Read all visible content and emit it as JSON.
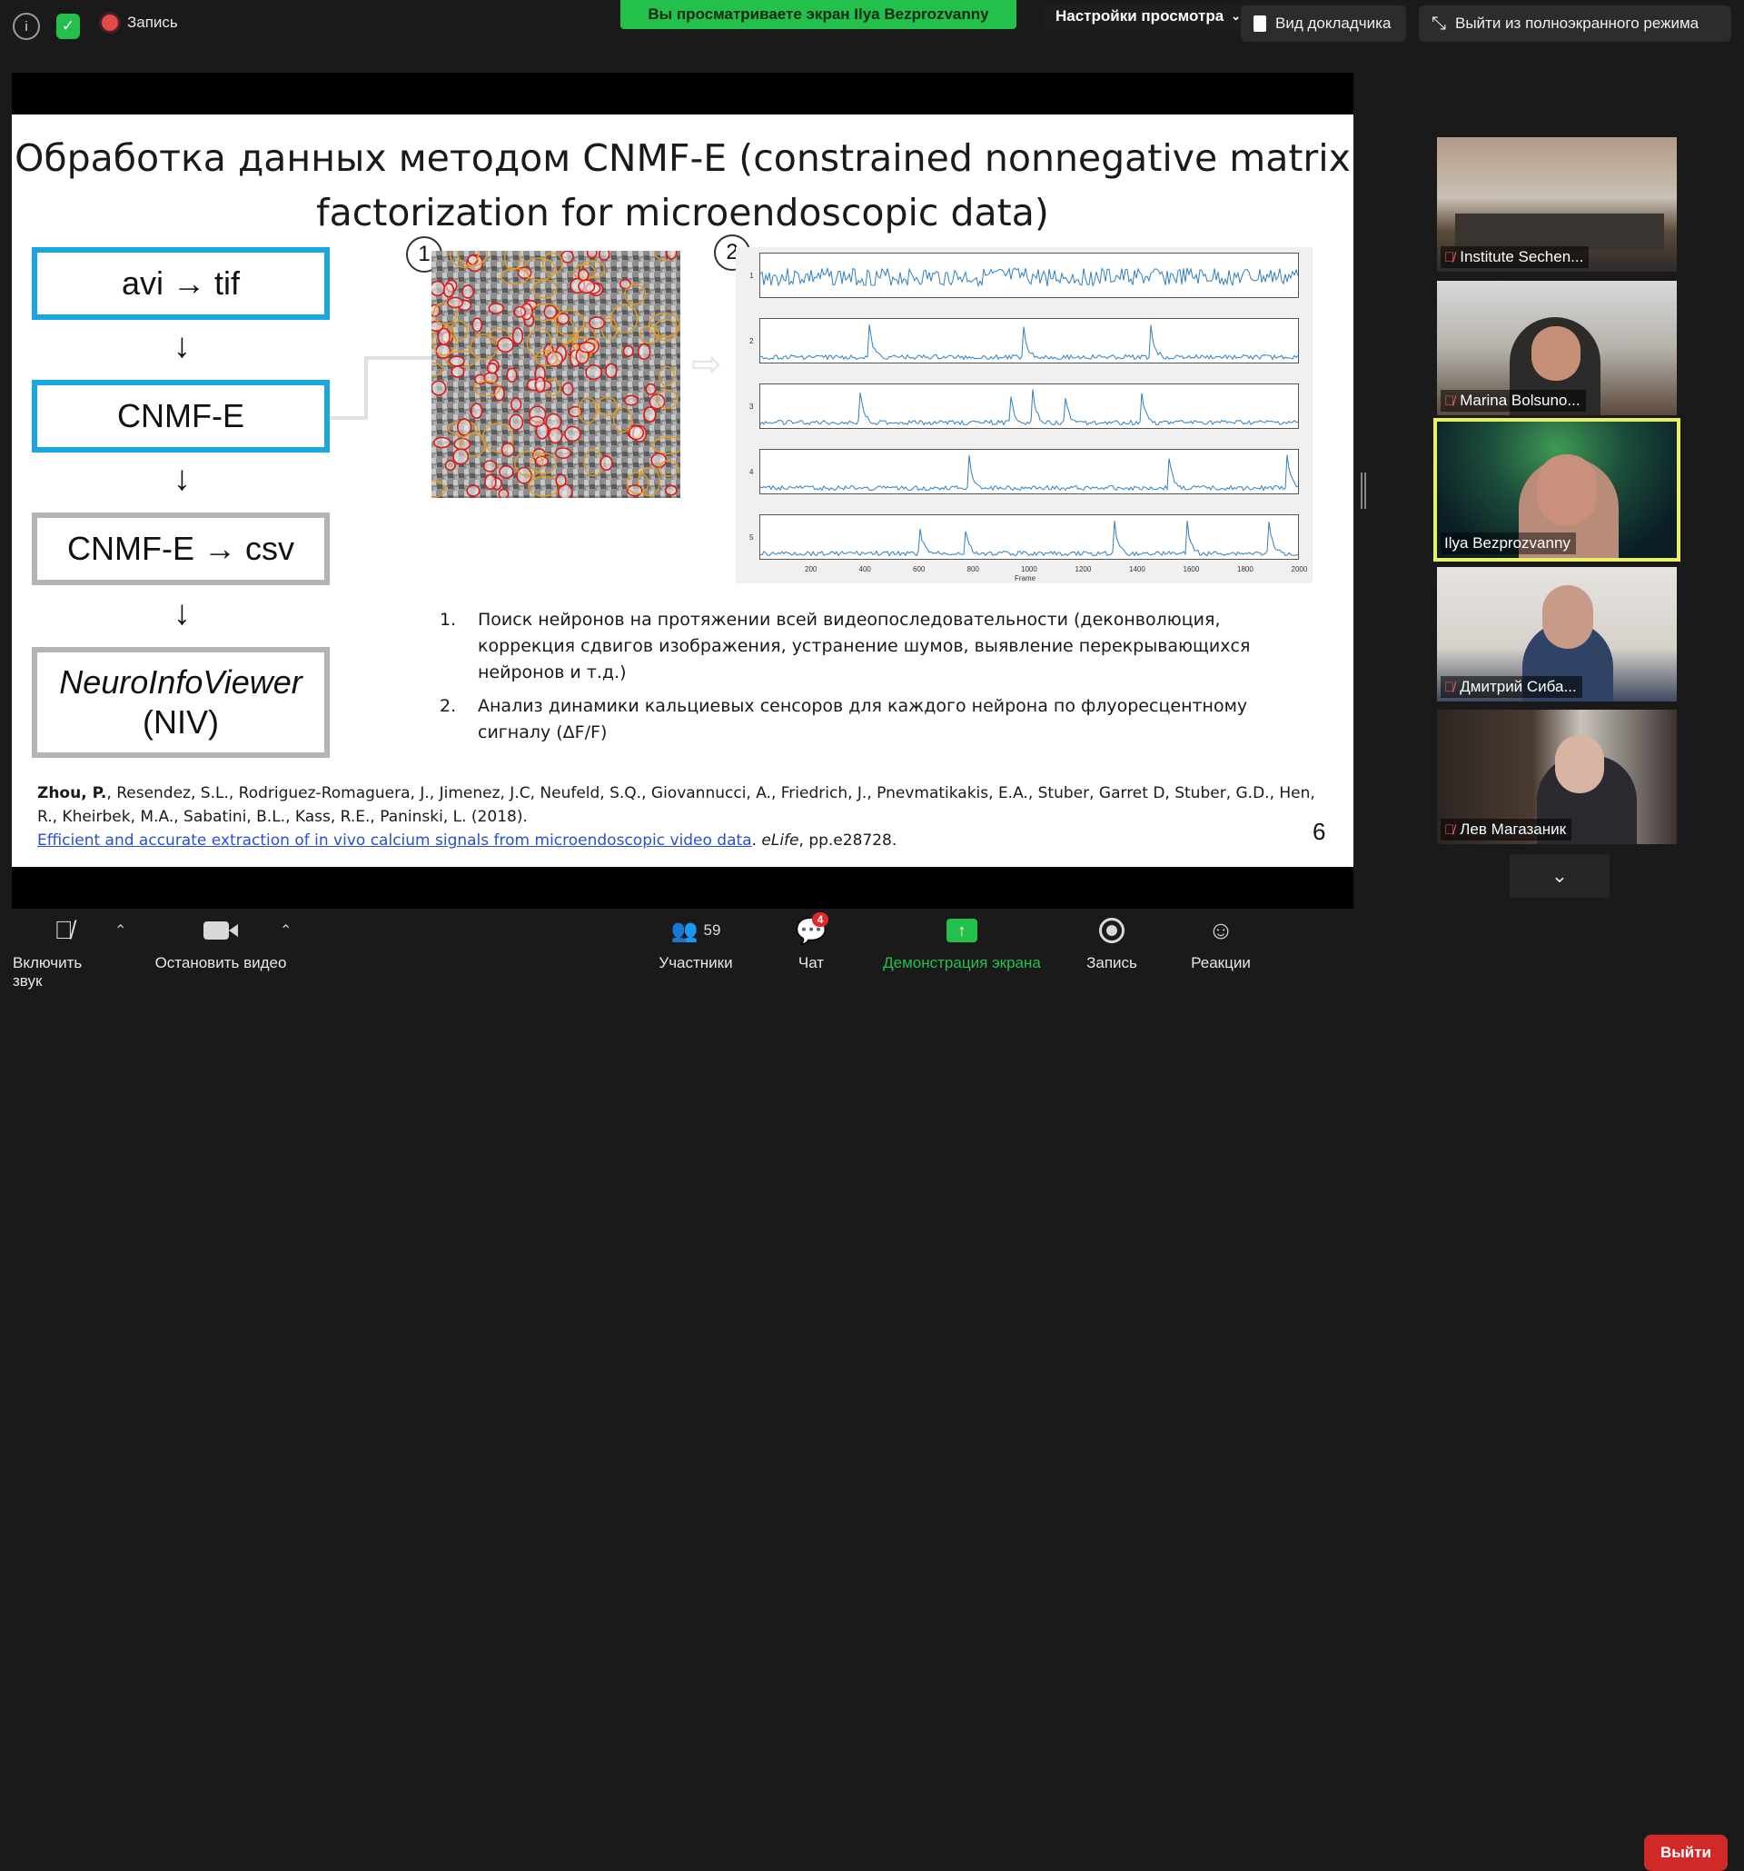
{
  "topbar": {
    "info_icon": "info-icon",
    "shield_icon": "shield-icon",
    "record_label": "Запись",
    "share_banner": "Вы просматриваете экран Ilya Bezprozvanny",
    "view_options": "Настройки просмотра",
    "speaker_view": "Вид докладчика",
    "exit_fullscreen": "Выйти из полноэкранного режима"
  },
  "slide": {
    "title_line1": "Обработка данных методом CNMF-E (constrained nonnegative matrix",
    "title_line2": "factorization for microendoscopic data)",
    "boxes": {
      "b1": "avi → tif",
      "b2": "CNMF-E",
      "b3": "CNMF-E → csv",
      "b4_line1": "NeuroInfoViewer",
      "b4_line2": "(NIV)"
    },
    "arrow": "↓",
    "marker1": "1",
    "marker2": "2",
    "traces": {
      "y_labels": [
        "1",
        "2",
        "3",
        "4",
        "5"
      ],
      "x_ticks": [
        "200",
        "400",
        "600",
        "800",
        "1000",
        "1200",
        "1400",
        "1600",
        "1800",
        "2000"
      ],
      "xlabel": "Frame",
      "colors": {
        "trace": "#2f7fbf",
        "neuron_red": "#e01818",
        "neuron_orange": "#e79a1c"
      }
    },
    "list": [
      {
        "n": "1.",
        "text": "Поиск нейронов на протяжении всей видеопоследовательности (деконволюция, коррекция сдвигов изображения, устранение шумов, выявление перекрывающихся нейронов и т.д.)"
      },
      {
        "n": "2.",
        "text": "Анализ динамики кальциевых сенсоров для каждого нейрона по флуоресцентному сигналу (ΔF/F)"
      }
    ],
    "ref": {
      "bold": "Zhou, P.",
      "authors": ", Resendez, S.L., Rodriguez-Romaguera, J., Jimenez, J.C, Neufeld, S.Q., Giovannucci, A., Friedrich, J., Pnevmatikakis, E.A., Stuber, Garret D, Stuber, G.D., Hen, R., Kheirbek, M.A., Sabatini, B.L., Kass, R.E., Paninski, L. (2018).",
      "link": "Efficient and accurate extraction of in vivo calcium signals from microendoscopic video data",
      "journal_sep": ". ",
      "journal": "eLife",
      "pages": ", pp.e28728."
    },
    "page_number": "6"
  },
  "participants": [
    {
      "name": "Institute Sechen...",
      "muted": true,
      "active": false
    },
    {
      "name": "Marina Bolsuno...",
      "muted": true,
      "active": false
    },
    {
      "name": "Ilya Bezprozvanny",
      "muted": false,
      "active": true
    },
    {
      "name": "Дмитрий Сиба...",
      "muted": true,
      "active": false
    },
    {
      "name": "Лев Магазаник",
      "muted": true,
      "active": false
    }
  ],
  "bottombar": {
    "unmute": "Включить звук",
    "stop_video": "Остановить видео",
    "participants_count": "59",
    "participants": "Участники",
    "chat_badge": "4",
    "chat": "Чат",
    "share_screen": "Демонстрация экрана",
    "record": "Запись",
    "reactions": "Реакции",
    "leave": "Выйти"
  }
}
